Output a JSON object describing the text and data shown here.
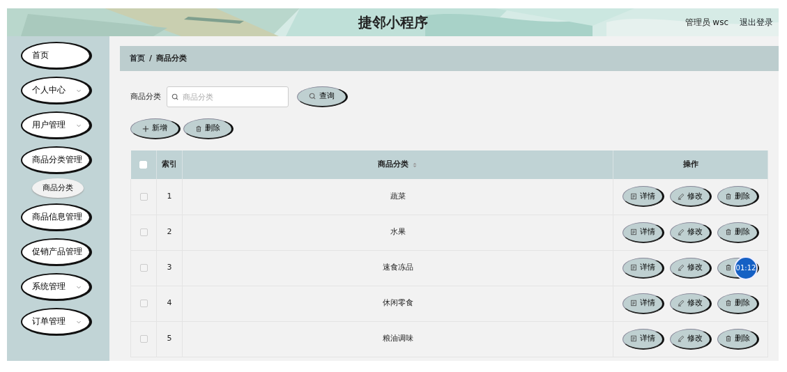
{
  "header": {
    "title": "捷邻小程序",
    "user": "管理员 wsc",
    "logout": "退出登录"
  },
  "sidebar": {
    "items": [
      {
        "label": "首页",
        "expandable": false
      },
      {
        "label": "个人中心",
        "expandable": true
      },
      {
        "label": "用户管理",
        "expandable": true
      },
      {
        "label": "商品分类管理",
        "expandable": false,
        "children": [
          {
            "label": "商品分类"
          }
        ]
      },
      {
        "label": "商品信息管理",
        "expandable": false
      },
      {
        "label": "促销产品管理",
        "expandable": false
      },
      {
        "label": "系统管理",
        "expandable": true
      },
      {
        "label": "订单管理",
        "expandable": true
      }
    ]
  },
  "breadcrumb": [
    "首页",
    "/",
    "商品分类"
  ],
  "search": {
    "label": "商品分类",
    "placeholder": "商品分类",
    "button": "查询"
  },
  "toolbar": [
    {
      "kind": "add",
      "label": "新增"
    },
    {
      "kind": "delete",
      "label": "删除"
    }
  ],
  "table": {
    "columns": [
      {
        "kind": "check",
        "checked": false
      },
      {
        "kind": "text",
        "label": "索引"
      },
      {
        "kind": "sort",
        "label": "商品分类"
      },
      {
        "kind": "text",
        "label": "操作"
      }
    ],
    "rows": [
      {
        "checked": false,
        "index": "1",
        "name": "蔬菜",
        "actions": [
          {
            "kind": "detail",
            "label": "详情"
          },
          {
            "kind": "edit",
            "label": "修改"
          },
          {
            "kind": "delete",
            "label": "删除"
          }
        ]
      },
      {
        "checked": false,
        "index": "2",
        "name": "水果",
        "actions": [
          {
            "kind": "detail",
            "label": "详情"
          },
          {
            "kind": "edit",
            "label": "修改"
          },
          {
            "kind": "delete",
            "label": "删除"
          }
        ]
      },
      {
        "checked": false,
        "index": "3",
        "name": "速食冻品",
        "actions": [
          {
            "kind": "detail",
            "label": "详情"
          },
          {
            "kind": "edit",
            "label": "修改"
          },
          {
            "kind": "delete",
            "timer": "01:12"
          }
        ]
      },
      {
        "checked": false,
        "index": "4",
        "name": "休闲零食",
        "actions": [
          {
            "kind": "detail",
            "label": "详情"
          },
          {
            "kind": "edit",
            "label": "修改"
          },
          {
            "kind": "delete",
            "label": "删除"
          }
        ]
      },
      {
        "checked": false,
        "index": "5",
        "name": "粮油调味",
        "actions": [
          {
            "kind": "detail",
            "label": "详情"
          },
          {
            "kind": "edit",
            "label": "修改"
          },
          {
            "kind": "delete",
            "label": "删除"
          }
        ]
      }
    ]
  }
}
